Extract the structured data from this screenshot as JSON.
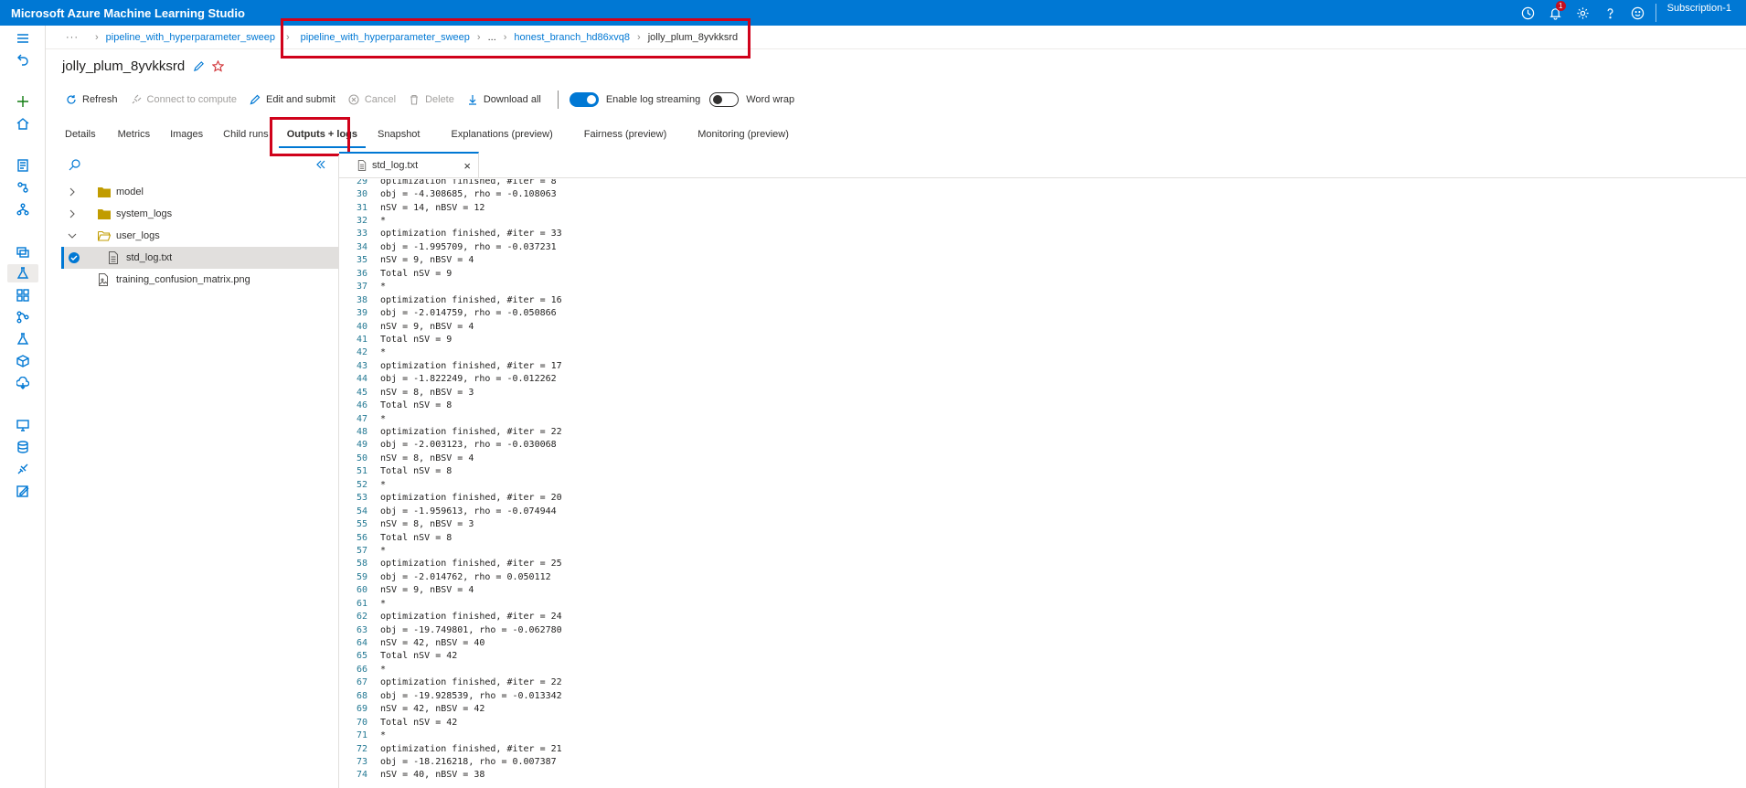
{
  "app": {
    "title": "Microsoft Azure Machine Learning Studio"
  },
  "topbar": {
    "notification_count": "1",
    "subscription": "Subscription-1",
    "icons": [
      "clock-icon",
      "bell-icon",
      "gear-icon",
      "help-icon",
      "smiley-icon"
    ]
  },
  "breadcrumb": {
    "more": "···",
    "items": [
      "pipeline_with_hyperparameter_sweep",
      "pipeline_with_hyperparameter_sweep",
      "...",
      "honest_branch_hd86xvq8",
      "jolly_plum_8yvkksrd"
    ]
  },
  "page": {
    "title": "jolly_plum_8yvkksrd"
  },
  "toolbar": {
    "refresh": "Refresh",
    "connect": "Connect to compute",
    "edit_submit": "Edit and submit",
    "cancel": "Cancel",
    "delete": "Delete",
    "download_all": "Download all",
    "log_streaming": "Enable log streaming",
    "word_wrap": "Word wrap"
  },
  "tabs": [
    "Details",
    "Metrics",
    "Images",
    "Child runs",
    "Outputs + logs",
    "Snapshot",
    "Explanations (preview)",
    "Fairness (preview)",
    "Monitoring (preview)"
  ],
  "active_tab": "Outputs + logs",
  "tree": {
    "items": [
      {
        "label": "model",
        "type": "folder"
      },
      {
        "label": "system_logs",
        "type": "folder"
      },
      {
        "label": "user_logs",
        "type": "folder-open"
      },
      {
        "label": "std_log.txt",
        "type": "file",
        "selected": true
      },
      {
        "label": "training_confusion_matrix.png",
        "type": "image"
      }
    ]
  },
  "file_tab": {
    "name": "std_log.txt"
  },
  "log_lines": [
    {
      "n": "29",
      "t": "optimization finished, #iter = 8"
    },
    {
      "n": "30",
      "t": "obj = -4.308685, rho = -0.108063"
    },
    {
      "n": "31",
      "t": "nSV = 14, nBSV = 12"
    },
    {
      "n": "32",
      "t": "*"
    },
    {
      "n": "33",
      "t": "optimization finished, #iter = 33"
    },
    {
      "n": "34",
      "t": "obj = -1.995709, rho = -0.037231"
    },
    {
      "n": "35",
      "t": "nSV = 9, nBSV = 4"
    },
    {
      "n": "36",
      "t": "Total nSV = 9"
    },
    {
      "n": "37",
      "t": "*"
    },
    {
      "n": "38",
      "t": "optimization finished, #iter = 16"
    },
    {
      "n": "39",
      "t": "obj = -2.014759, rho = -0.050866"
    },
    {
      "n": "40",
      "t": "nSV = 9, nBSV = 4"
    },
    {
      "n": "41",
      "t": "Total nSV = 9"
    },
    {
      "n": "42",
      "t": "*"
    },
    {
      "n": "43",
      "t": "optimization finished, #iter = 17"
    },
    {
      "n": "44",
      "t": "obj = -1.822249, rho = -0.012262"
    },
    {
      "n": "45",
      "t": "nSV = 8, nBSV = 3"
    },
    {
      "n": "46",
      "t": "Total nSV = 8"
    },
    {
      "n": "47",
      "t": "*"
    },
    {
      "n": "48",
      "t": "optimization finished, #iter = 22"
    },
    {
      "n": "49",
      "t": "obj = -2.003123, rho = -0.030068"
    },
    {
      "n": "50",
      "t": "nSV = 8, nBSV = 4"
    },
    {
      "n": "51",
      "t": "Total nSV = 8"
    },
    {
      "n": "52",
      "t": "*"
    },
    {
      "n": "53",
      "t": "optimization finished, #iter = 20"
    },
    {
      "n": "54",
      "t": "obj = -1.959613, rho = -0.074944"
    },
    {
      "n": "55",
      "t": "nSV = 8, nBSV = 3"
    },
    {
      "n": "56",
      "t": "Total nSV = 8"
    },
    {
      "n": "57",
      "t": "*"
    },
    {
      "n": "58",
      "t": "optimization finished, #iter = 25"
    },
    {
      "n": "59",
      "t": "obj = -2.014762, rho = 0.050112"
    },
    {
      "n": "60",
      "t": "nSV = 9, nBSV = 4"
    },
    {
      "n": "61",
      "t": "*"
    },
    {
      "n": "62",
      "t": "optimization finished, #iter = 24"
    },
    {
      "n": "63",
      "t": "obj = -19.749801, rho = -0.062780"
    },
    {
      "n": "64",
      "t": "nSV = 42, nBSV = 40"
    },
    {
      "n": "65",
      "t": "Total nSV = 42"
    },
    {
      "n": "66",
      "t": "*"
    },
    {
      "n": "67",
      "t": "optimization finished, #iter = 22"
    },
    {
      "n": "68",
      "t": "obj = -19.928539, rho = -0.013342"
    },
    {
      "n": "69",
      "t": "nSV = 42, nBSV = 42"
    },
    {
      "n": "70",
      "t": "Total nSV = 42"
    },
    {
      "n": "71",
      "t": "*"
    },
    {
      "n": "72",
      "t": "optimization finished, #iter = 21"
    },
    {
      "n": "73",
      "t": "obj = -18.216218, rho = 0.007387"
    },
    {
      "n": "74",
      "t": "nSV = 40, nBSV = 38"
    }
  ],
  "colors": {
    "accent": "#0078d4",
    "highlight": "#d0021b",
    "folder": "#c19c00"
  }
}
